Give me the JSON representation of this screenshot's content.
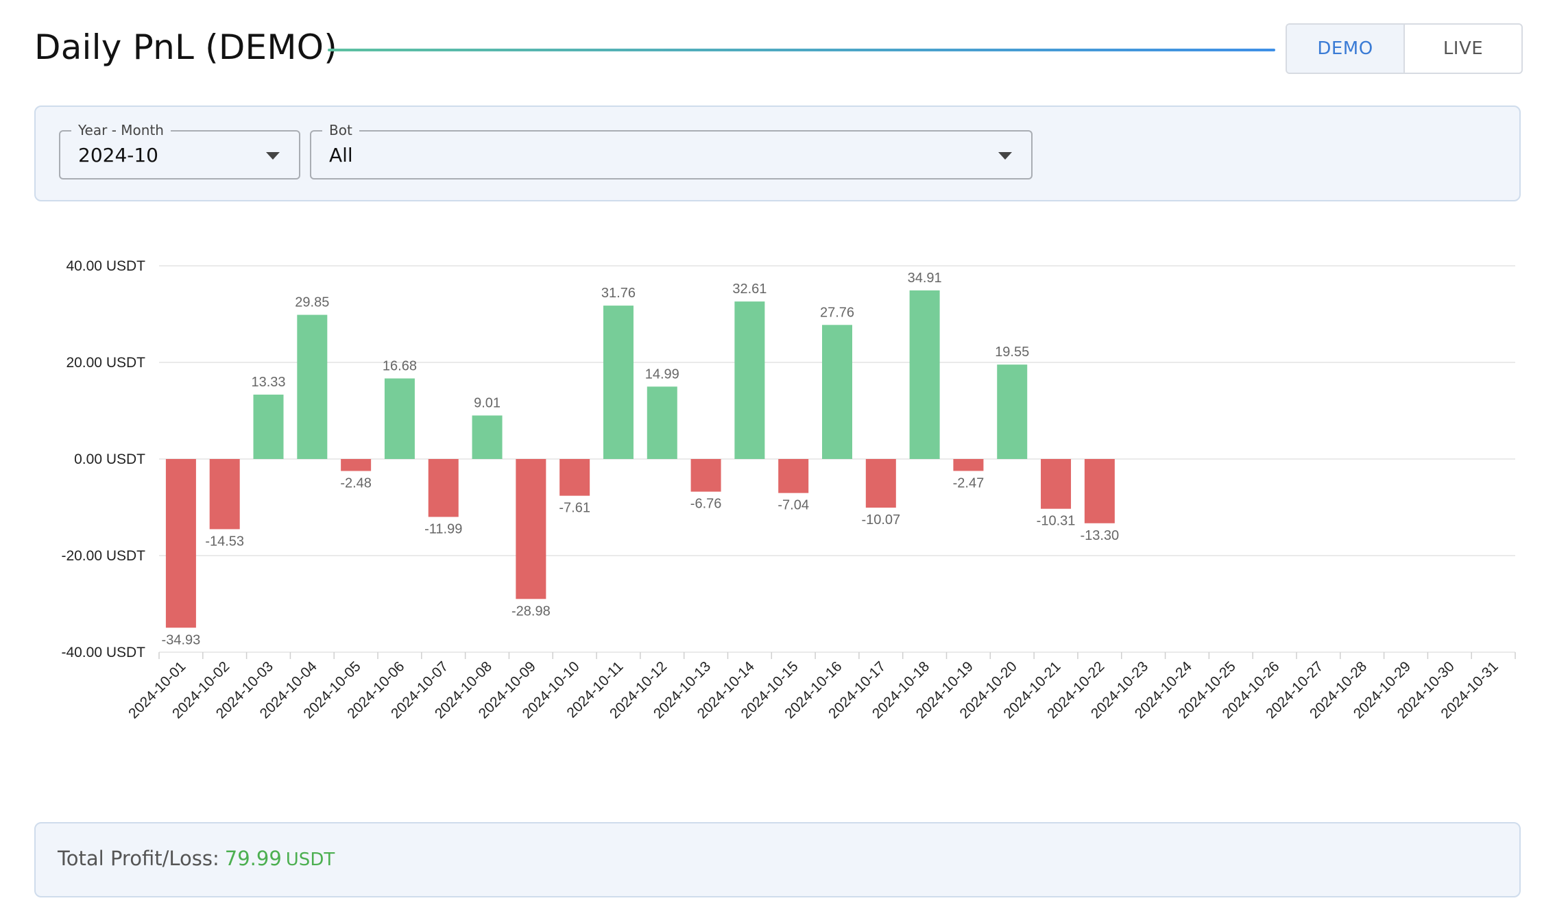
{
  "page": {
    "title": "Daily PnL (DEMO)"
  },
  "mode_toggle": {
    "demo_label": "DEMO",
    "live_label": "LIVE",
    "selected": "DEMO"
  },
  "filters": {
    "year_month": {
      "label": "Year - Month",
      "value": "2024-10"
    },
    "bot": {
      "label": "Bot",
      "value": "All"
    }
  },
  "summary": {
    "label": "Total Profit/Loss:",
    "value": "79.99",
    "unit": "USDT"
  },
  "colors": {
    "positive": "#77cd98",
    "negative": "#e06666",
    "accent": "#3a7bd5",
    "total_value": "#4caf50"
  },
  "chart_data": {
    "type": "bar",
    "categories": [
      "2024-10-01",
      "2024-10-02",
      "2024-10-03",
      "2024-10-04",
      "2024-10-05",
      "2024-10-06",
      "2024-10-07",
      "2024-10-08",
      "2024-10-09",
      "2024-10-10",
      "2024-10-11",
      "2024-10-12",
      "2024-10-13",
      "2024-10-14",
      "2024-10-15",
      "2024-10-16",
      "2024-10-17",
      "2024-10-18",
      "2024-10-19",
      "2024-10-20",
      "2024-10-21",
      "2024-10-22",
      "2024-10-23",
      "2024-10-24",
      "2024-10-25",
      "2024-10-26",
      "2024-10-27",
      "2024-10-28",
      "2024-10-29",
      "2024-10-30",
      "2024-10-31"
    ],
    "values": [
      -34.93,
      -14.53,
      13.33,
      29.85,
      -2.48,
      16.68,
      -11.99,
      9.01,
      -28.98,
      -7.61,
      31.76,
      14.99,
      -6.76,
      32.61,
      -7.04,
      27.76,
      -10.07,
      34.91,
      -2.47,
      19.55,
      -10.31,
      -13.3,
      null,
      null,
      null,
      null,
      null,
      null,
      null,
      null,
      null
    ],
    "labels": [
      "-34.93",
      "-14.53",
      "13.33",
      "29.85",
      "-2.48",
      "16.68",
      "-11.99",
      "9.01",
      "-28.98",
      "-7.61",
      "31.76",
      "14.99",
      "-6.76",
      "32.61",
      "-7.04",
      "27.76",
      "-10.07",
      "34.91",
      "-2.47",
      "19.55",
      "-10.31",
      "-13.30",
      "",
      "",
      "",
      "",
      "",
      "",
      "",
      "",
      ""
    ],
    "yticks": [
      40,
      20,
      0,
      -20,
      -40
    ],
    "ytick_labels": [
      "40.00 USDT",
      "20.00 USDT",
      "0.00 USDT",
      "-20.00 USDT",
      "-40.00 USDT"
    ],
    "ylim": [
      -40,
      40
    ],
    "grid": true,
    "legend": false,
    "xlabel": "",
    "ylabel": ""
  }
}
